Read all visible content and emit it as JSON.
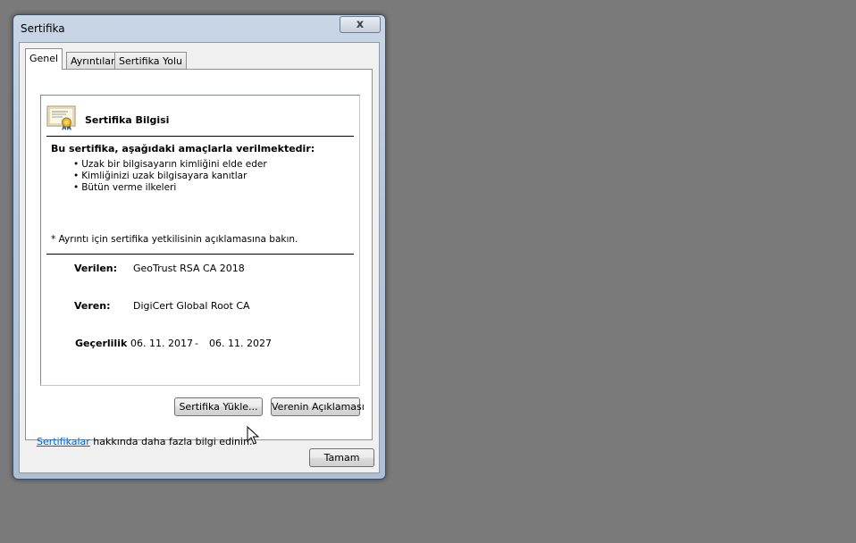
{
  "window": {
    "title": "Sertifika",
    "close_glyph": "x"
  },
  "tabs": [
    {
      "label": "Genel",
      "active": true
    },
    {
      "label": "Ayrıntılar",
      "active": false
    },
    {
      "label": "Sertifika Yolu",
      "active": false
    }
  ],
  "info": {
    "title": "Sertifika Bilgisi",
    "icon": "certificate-icon",
    "purpose_heading": "Bu sertifika, aşağıdaki amaçlarla verilmektedir:",
    "purposes": [
      "Uzak bir bilgisayarın kimliğini elde eder",
      "Kimliğinizi uzak bilgisayara kanıtlar",
      "Bütün verme ilkeleri"
    ],
    "note": "* Ayrıntı için sertifika yetkilisinin açıklamasına bakın.",
    "issued_to_label": "Verilen:",
    "issued_to": "GeoTrust RSA CA 2018",
    "issued_by_label": "Veren:",
    "issued_by": "DigiCert Global Root CA",
    "validity_label": "Geçerlilik",
    "valid_from": "06. 11. 2017",
    "valid_sep": "-",
    "valid_to": "06. 11. 2027"
  },
  "buttons": {
    "install": "Sertifika Yükle...",
    "issuer_statement": "Verenin Açıklaması",
    "ok": "Tamam"
  },
  "learn_more": {
    "link": "Sertifikalar",
    "text": " hakkında daha fazla bilgi edinin."
  }
}
